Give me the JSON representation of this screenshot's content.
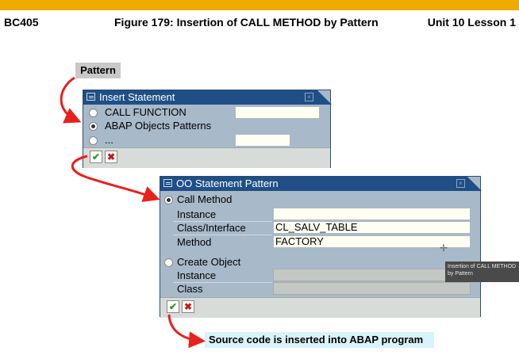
{
  "header": {
    "course": "BC405",
    "figure": "Figure 179: Insertion of CALL METHOD by Pattern",
    "unit": "Unit 10 Lesson 1"
  },
  "pattern_button": "Pattern",
  "insert_dialog": {
    "title": "Insert Statement",
    "options": [
      {
        "label": "CALL FUNCTION",
        "selected": false,
        "field_value": ""
      },
      {
        "label": "ABAP Objects Patterns",
        "selected": true
      },
      {
        "label": "...",
        "selected": false,
        "field_value": ""
      }
    ]
  },
  "oo_dialog": {
    "title": "OO Statement Pattern",
    "call_method": {
      "label": "Call Method",
      "selected": true,
      "rows": [
        {
          "label": "Instance",
          "value": ""
        },
        {
          "label": "Class/Interface",
          "value": "CL_SALV_TABLE"
        },
        {
          "label": "Method",
          "value": "FACTORY"
        }
      ]
    },
    "create_object": {
      "label": "Create Object",
      "selected": false,
      "rows": [
        {
          "label": "Instance",
          "value": ""
        },
        {
          "label": "Class",
          "value": ""
        }
      ]
    }
  },
  "tooltip": "Insertion of CALL METHOD by Pattern",
  "note": "Source code is inserted into ABAP program",
  "icons": {
    "confirm": "green-checkmark",
    "cancel": "red-x"
  },
  "colors": {
    "accent_bar": "#f0ab00",
    "title_bar": "#1f4f86",
    "dialog_body": "#a8b9c9",
    "arrow": "#e8211c",
    "note_bg": "#d9f3fb"
  }
}
